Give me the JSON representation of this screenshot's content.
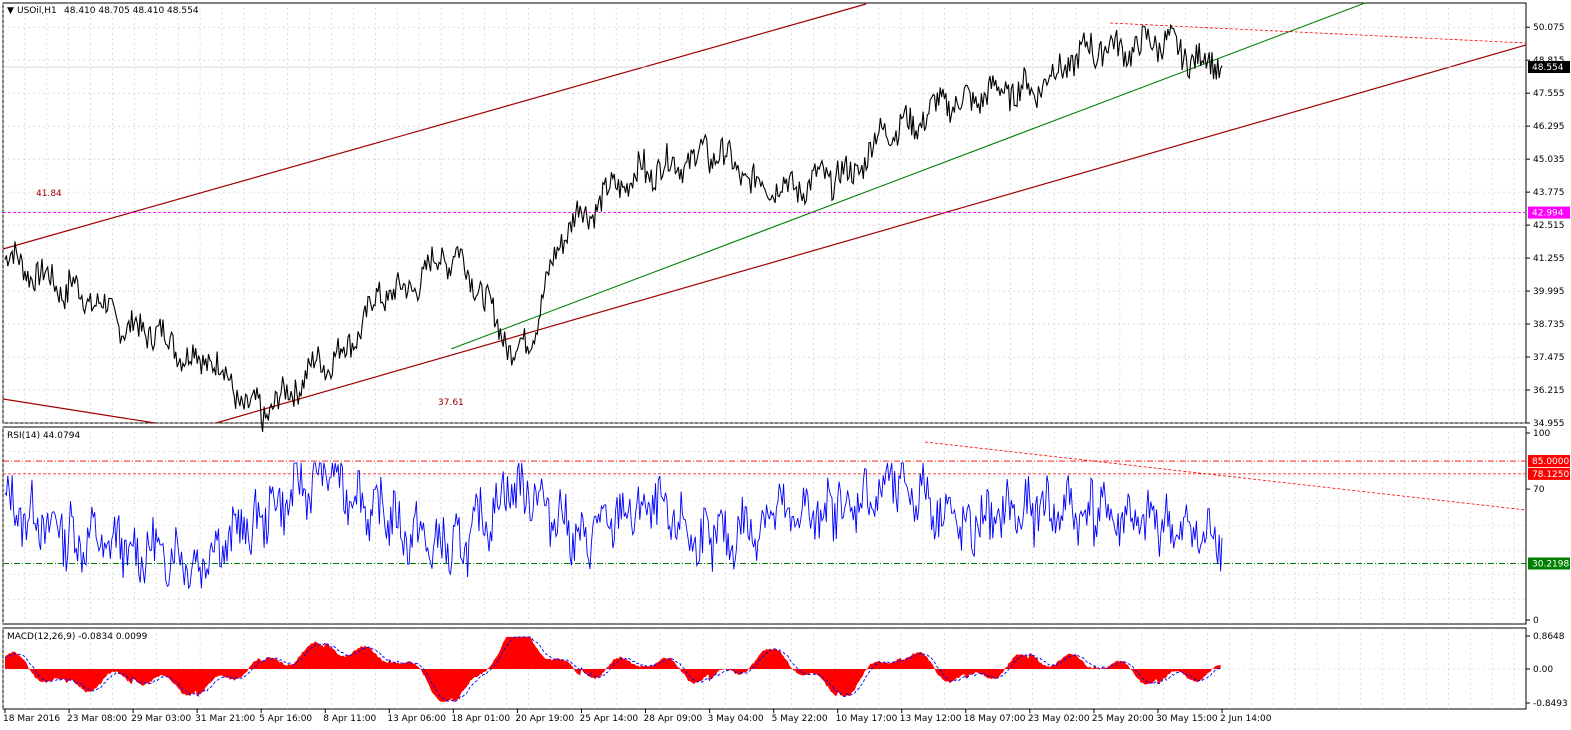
{
  "colors": {
    "price": "#000000",
    "grid": "#c8c8c8",
    "channel": "#a00000",
    "trend": "#008000",
    "magenta": "#ff00ff",
    "rsi": "#0000ff",
    "rsi_levels": "#ff0000",
    "rsi_low": "#008000",
    "macd_hist": "#ff0000",
    "macd_signal": "#0000ff",
    "text": "#000000",
    "label_bg": "#000000"
  },
  "main": {
    "title": "USOil,H1",
    "ohlc": "48.410 48.705 48.410 48.554",
    "last_price_label": "48.554",
    "hline_label": "42.994",
    "annotation_high": "41.84",
    "annotation_low": "37.61",
    "y_ticks": [
      "50.075",
      "48.815",
      "47.555",
      "46.295",
      "45.035",
      "43.775",
      "42.515",
      "41.255",
      "39.995",
      "38.735",
      "37.475",
      "36.215",
      "34.955"
    ]
  },
  "rsi": {
    "title": "RSI(14) 44.0794",
    "y_ticks": [
      "100",
      "70",
      "0"
    ],
    "level_labels": [
      "85.0000",
      "78.1250",
      "30.2198"
    ]
  },
  "macd": {
    "title": "MACD(12,26,9) -0.0834 0.0099",
    "y_ticks": [
      "0.8648",
      "0.00",
      "-0.8493"
    ]
  },
  "x_ticks": [
    "18 Mar 2016",
    "23 Mar 08:00",
    "29 Mar 03:00",
    "31 Mar 21:00",
    "5 Apr 16:00",
    "8 Apr 11:00",
    "13 Apr 06:00",
    "18 Apr 01:00",
    "20 Apr 19:00",
    "25 Apr 14:00",
    "28 Apr 09:00",
    "3 May 04:00",
    "5 May 22:00",
    "10 May 17:00",
    "13 May 12:00",
    "18 May 07:00",
    "23 May 02:00",
    "25 May 20:00",
    "30 May 15:00",
    "2 Jun 14:00"
  ],
  "chart_data": [
    {
      "type": "line",
      "title": "USOil,H1",
      "x": [
        "18 Mar 2016",
        "23 Mar 08:00",
        "29 Mar 03:00",
        "31 Mar 21:00",
        "5 Apr 16:00",
        "8 Apr 11:00",
        "13 Apr 06:00",
        "18 Apr 01:00",
        "20 Apr 19:00",
        "25 Apr 14:00",
        "28 Apr 09:00",
        "3 May 04:00",
        "5 May 22:00",
        "10 May 17:00",
        "13 May 12:00",
        "18 May 07:00",
        "23 May 02:00",
        "25 May 20:00",
        "30 May 15:00",
        "2 Jun 14:00"
      ],
      "series": [
        {
          "values": [
            41.2,
            40.1,
            38.7,
            37.6,
            35.4,
            37.2,
            39.8,
            41.3,
            37.9,
            43.1,
            44.6,
            45.2,
            43.9,
            44.3,
            46.4,
            47.4,
            47.8,
            49.2,
            49.4,
            48.6
          ]
        }
      ],
      "ylim": [
        34.955,
        51.0
      ],
      "grid": true,
      "last_value": 48.554,
      "hline": 42.994,
      "annotations": [
        "41.84",
        "37.61"
      ]
    },
    {
      "type": "line",
      "title": "RSI(14) 44.0794",
      "x": [
        "18 Mar 2016",
        "23 Mar 08:00",
        "29 Mar 03:00",
        "31 Mar 21:00",
        "5 Apr 16:00",
        "8 Apr 11:00",
        "13 Apr 06:00",
        "18 Apr 01:00",
        "20 Apr 19:00",
        "25 Apr 14:00",
        "28 Apr 09:00",
        "3 May 04:00",
        "5 May 22:00",
        "10 May 17:00",
        "13 May 12:00",
        "18 May 07:00",
        "23 May 02:00",
        "25 May 20:00",
        "30 May 15:00",
        "2 Jun 14:00"
      ],
      "series": [
        {
          "values": [
            62,
            45,
            38,
            33,
            55,
            80,
            52,
            35,
            75,
            44,
            62,
            40,
            55,
            58,
            74,
            50,
            60,
            58,
            50,
            44
          ]
        }
      ],
      "ylim": [
        0,
        100
      ],
      "levels": [
        85.0,
        78.125,
        30.2198
      ],
      "last_value": 44.0794
    },
    {
      "type": "bar",
      "title": "MACD(12,26,9) -0.0834 0.0099",
      "x": [
        "18 Mar 2016",
        "23 Mar 08:00",
        "29 Mar 03:00",
        "31 Mar 21:00",
        "5 Apr 16:00",
        "8 Apr 11:00",
        "13 Apr 06:00",
        "18 Apr 01:00",
        "20 Apr 19:00",
        "25 Apr 14:00",
        "28 Apr 09:00",
        "3 May 04:00",
        "5 May 22:00",
        "10 May 17:00",
        "13 May 12:00",
        "18 May 07:00",
        "23 May 02:00",
        "25 May 20:00",
        "30 May 15:00",
        "2 Jun 14:00"
      ],
      "series": [
        {
          "values": [
            0.3,
            -0.45,
            -0.2,
            -0.5,
            0.1,
            0.55,
            0.35,
            -0.75,
            0.85,
            -0.1,
            0.25,
            -0.25,
            0.35,
            -0.55,
            0.4,
            -0.3,
            0.25,
            0.2,
            -0.25,
            -0.0834
          ]
        }
      ],
      "ylim": [
        -0.8493,
        0.8648
      ],
      "last_macd": -0.0834,
      "last_signal": 0.0099
    }
  ]
}
